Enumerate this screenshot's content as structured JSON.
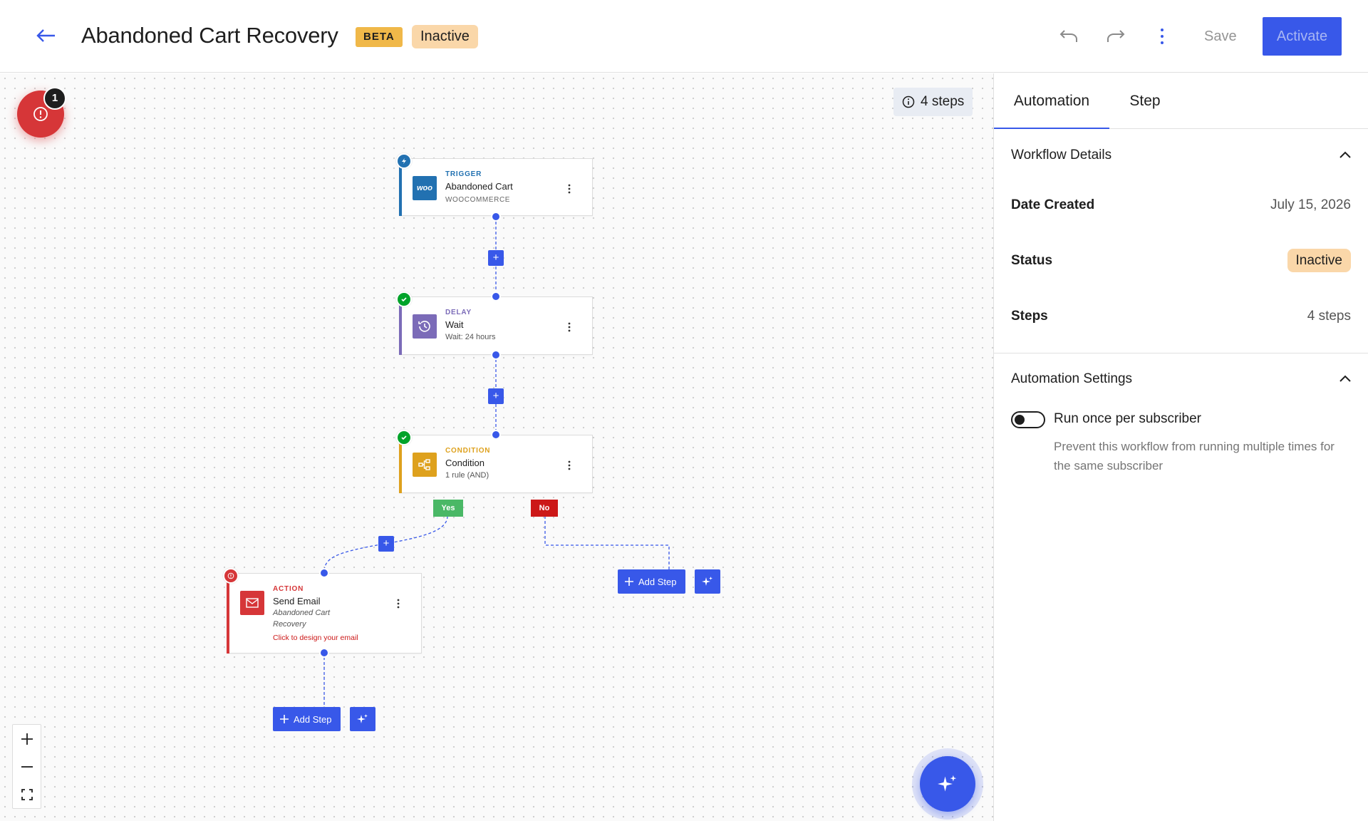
{
  "header": {
    "title": "Abandoned Cart Recovery",
    "beta_label": "BETA",
    "status_label": "Inactive",
    "save_label": "Save",
    "activate_label": "Activate",
    "icons": [
      "arrow-left-icon",
      "undo-icon",
      "redo-icon",
      "more-vertical-icon"
    ]
  },
  "canvas": {
    "alert_count": "1",
    "steps_count_label": "4 steps",
    "nodes": {
      "trigger": {
        "type": "TRIGGER",
        "title": "Abandoned Cart",
        "subtitle": "WOOCOMMERCE",
        "icon_text": "woo",
        "color": "#2271b1"
      },
      "delay": {
        "type": "DELAY",
        "title": "Wait",
        "subtitle": "Wait: 24 hours",
        "color": "#7b6bb8"
      },
      "condition": {
        "type": "CONDITION",
        "title": "Condition",
        "subtitle": "1 rule (AND)",
        "color": "#dea11d"
      },
      "action": {
        "type": "ACTION",
        "title": "Send Email",
        "subtitle_line1": "Abandoned Cart",
        "subtitle_line2": "Recovery",
        "warning": "Click to design your email",
        "color": "#d63638"
      }
    },
    "branches": {
      "yes": "Yes",
      "no": "No"
    },
    "add_step_label": "Add Step",
    "plus_label": "+"
  },
  "sidebar": {
    "tabs": [
      {
        "label": "Automation",
        "active": true
      },
      {
        "label": "Step",
        "active": false
      }
    ],
    "workflow_details": {
      "heading": "Workflow Details",
      "rows": [
        {
          "label": "Date Created",
          "value": "July 15, 2026"
        },
        {
          "label": "Status",
          "value": "Inactive"
        },
        {
          "label": "Steps",
          "value": "4 steps"
        }
      ]
    },
    "automation_settings": {
      "heading": "Automation Settings",
      "toggle_label": "Run once per subscriber",
      "toggle_on": false,
      "help_text": "Prevent this workflow from running multiple times for the same subscriber"
    }
  },
  "colors": {
    "accent": "#3858e9",
    "warning_badge": "#f0b849",
    "inactive_badge": "#fad7a9",
    "success": "#4ab866",
    "error": "#cc1818"
  }
}
